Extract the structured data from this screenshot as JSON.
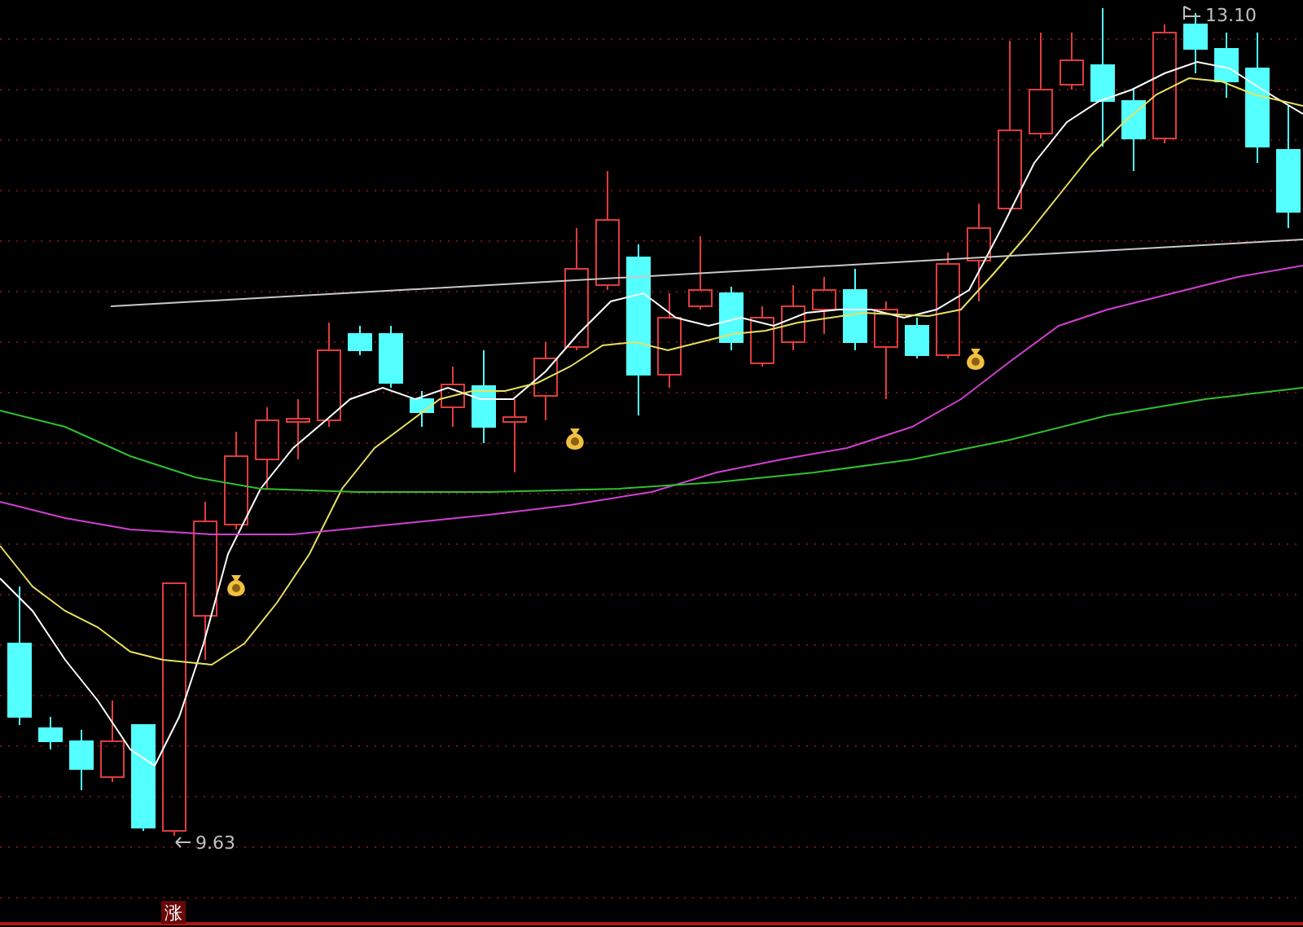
{
  "chart": {
    "high_label": "13.10",
    "low_label": "9.63"
  },
  "badge": "涨"
}
